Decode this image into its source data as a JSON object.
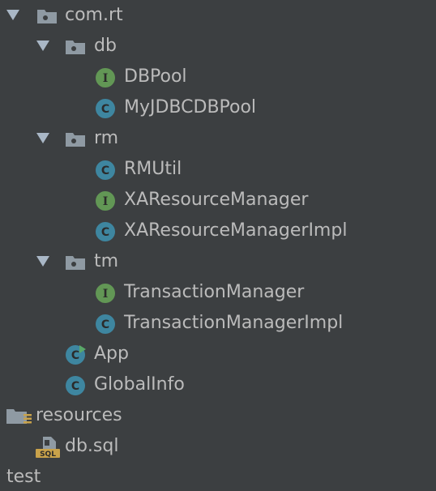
{
  "tree": {
    "root_package": {
      "label": "com.rt",
      "icon": "package-folder-icon"
    },
    "db": {
      "label": "db",
      "icon": "package-folder-icon",
      "items": [
        {
          "label": "DBPool",
          "icon": "interface-icon"
        },
        {
          "label": "MyJDBCDBPool",
          "icon": "class-icon"
        }
      ]
    },
    "rm": {
      "label": "rm",
      "icon": "package-folder-icon",
      "items": [
        {
          "label": "RMUtil",
          "icon": "class-icon"
        },
        {
          "label": "XAResourceManager",
          "icon": "interface-icon"
        },
        {
          "label": "XAResourceManagerImpl",
          "icon": "class-icon"
        }
      ]
    },
    "tm": {
      "label": "tm",
      "icon": "package-folder-icon",
      "items": [
        {
          "label": "TransactionManager",
          "icon": "interface-icon"
        },
        {
          "label": "TransactionManagerImpl",
          "icon": "class-icon"
        }
      ]
    },
    "app": {
      "label": "App",
      "icon": "runnable-class-icon"
    },
    "global_info": {
      "label": "GlobalInfo",
      "icon": "class-icon"
    },
    "resources": {
      "label": "resources",
      "icon": "resources-folder-icon"
    },
    "db_sql": {
      "label": "db.sql",
      "icon": "sql-file-icon",
      "badge": "SQL"
    },
    "test": {
      "label": "test"
    }
  },
  "colors": {
    "background": "#3c3f41",
    "text": "#bbbbbb",
    "chevron": "#a9b7c6",
    "folder": "#8f9aa3",
    "class_badge": "#3e86a0",
    "interface_badge": "#629755",
    "run_marker": "#59a869",
    "sql_badge": "#c9a24a"
  }
}
